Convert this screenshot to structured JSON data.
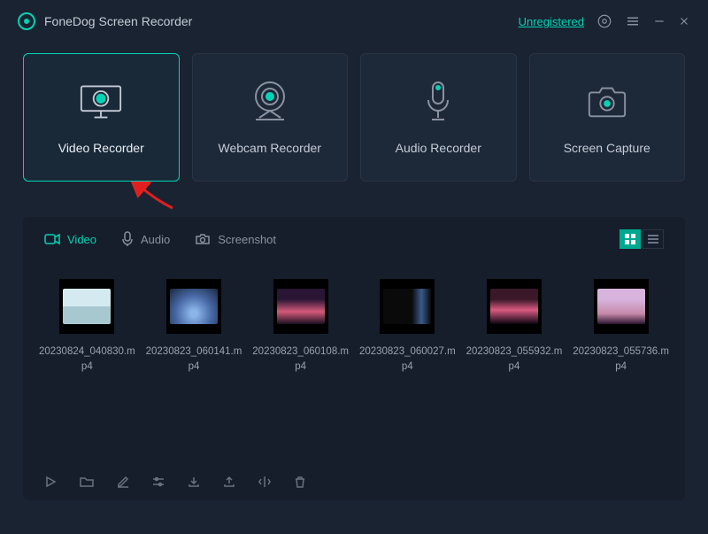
{
  "app": {
    "title": "FoneDog Screen Recorder",
    "unregistered_label": "Unregistered"
  },
  "modes": [
    {
      "id": "video-recorder",
      "label": "Video Recorder",
      "active": true
    },
    {
      "id": "webcam-recorder",
      "label": "Webcam Recorder",
      "active": false
    },
    {
      "id": "audio-recorder",
      "label": "Audio Recorder",
      "active": false
    },
    {
      "id": "screen-capture",
      "label": "Screen Capture",
      "active": false
    }
  ],
  "library": {
    "tabs": {
      "video": "Video",
      "audio": "Audio",
      "screenshot": "Screenshot"
    },
    "active_tab": "video",
    "view_mode": "grid",
    "files": [
      {
        "name": "20230824_040830.mp4"
      },
      {
        "name": "20230823_060141.mp4"
      },
      {
        "name": "20230823_060108.mp4"
      },
      {
        "name": "20230823_060027.mp4"
      },
      {
        "name": "20230823_055932.mp4"
      },
      {
        "name": "20230823_055736.mp4"
      }
    ]
  },
  "colors": {
    "accent": "#00d4b5",
    "bg": "#1a2332",
    "panel": "#161e2c"
  }
}
